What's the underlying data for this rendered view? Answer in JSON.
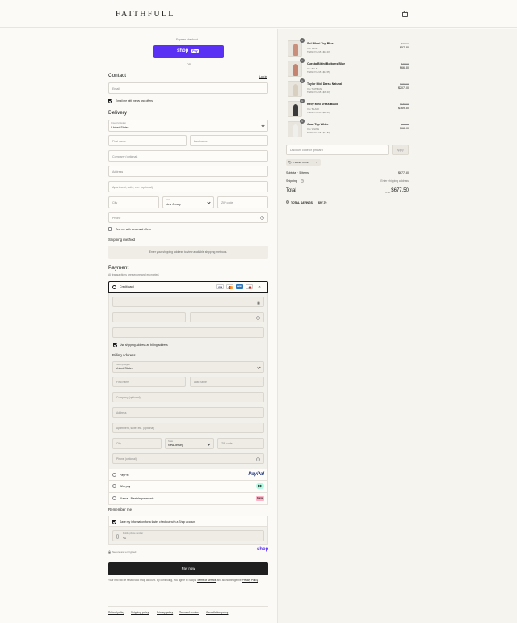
{
  "brand": "FAITHFULL",
  "express": {
    "label": "Express checkout",
    "shop_pay": "shop",
    "shop_pay_badge": "Pay",
    "or": "OR"
  },
  "contact": {
    "heading": "Contact",
    "login": "Log in",
    "email_placeholder": "Email",
    "newsletter_label": "Email me with news and offers"
  },
  "delivery": {
    "heading": "Delivery",
    "country_label": "Country/Region",
    "country_value": "United States",
    "first_name": "First name",
    "last_name": "Last name",
    "company": "Company (optional)",
    "address": "Address",
    "apartment": "Apartment, suite, etc. (optional)",
    "city": "City",
    "state_label": "State",
    "state_value": "New Jersey",
    "zip": "ZIP code",
    "phone": "Phone",
    "sms_label": "Text me with news and offers"
  },
  "shipping": {
    "heading": "Shipping method",
    "notice": "Enter your shipping address to view available shipping methods."
  },
  "payment": {
    "heading": "Payment",
    "subtext": "All transactions are secure and encrypted.",
    "credit_card": "Credit card",
    "cards": [
      "VISA",
      "MC",
      "AMEX",
      "D"
    ],
    "more_cards": "+5",
    "use_shipping": "Use shipping address as billing address",
    "billing_heading": "Billing address",
    "billing": {
      "country_label": "Country/Region",
      "country_value": "United States",
      "first_name": "First name",
      "last_name": "Last name",
      "company": "Company (optional)",
      "address": "Address",
      "apartment": "Apartment, suite, etc. (optional)",
      "city": "City",
      "state_label": "State",
      "state_value": "New Jersey",
      "zip": "ZIP code",
      "phone": "Phone (optional)"
    },
    "paypal": "PayPal",
    "paypal_logo": "PayPal",
    "afterpay": "Afterpay",
    "klarna": "Klarna - Flexible payments",
    "klarna_logo": "Klarna."
  },
  "remember": {
    "heading": "Remember me",
    "save_label": "Save my information for a faster checkout with a Shop account",
    "mobile_label": "Mobile phone number",
    "mobile_value": "+1",
    "secure_text": "Secure and encrypted",
    "shop_logo": "shop"
  },
  "pay_now": "Pay now",
  "legal": {
    "before": "Your info will be saved to a Shop account. By continuing, you agree to Shop's",
    "terms": "Terms of Service",
    "middle": "and acknowledge the",
    "privacy": "Privacy Policy"
  },
  "footer_links": [
    "Refund policy",
    "Shipping policy",
    "Privacy policy",
    "Terms of service",
    "Cancellation policy"
  ],
  "items": [
    {
      "qty": "1",
      "name": "Sol Bikini Top Blue",
      "variant": "XS / BLUE",
      "tag": "THANKYOU15 (-$10.00)",
      "old": "$68.00",
      "new": "$57.80",
      "color": "#c98f7a"
    },
    {
      "qty": "1",
      "name": "Cuesta Bikini Bottoms Blue",
      "variant": "XS / BLUE",
      "tag": "THANKYOU15 (-$11.55)",
      "old": "$78.00",
      "new": "$66.30",
      "color": "#c4846f"
    },
    {
      "qty": "1",
      "name": "Taylor Midi Dress Natural",
      "variant": "XS / NATURAL",
      "tag": "THANKYOU15 (-$35.00)",
      "old": "$269.00",
      "new": "$207.00",
      "color": "#d8cfc0"
    },
    {
      "qty": "1",
      "name": "Kelly Mini Dress Black",
      "variant": "XS / BLACK",
      "tag": "THANKYOU15 (-$28.00)",
      "old": "$189.00",
      "new": "$169.30",
      "color": "#3a3a3a"
    },
    {
      "qty": "1",
      "name": "Joan Top White",
      "variant": "XS / WHITE",
      "tag": "THANKYOU15 (-$12.80)",
      "old": "$85.00",
      "new": "$68.00",
      "color": "#efefec"
    }
  ],
  "discount": {
    "placeholder": "Discount code or gift card",
    "apply": "Apply",
    "code": "THANKYOU15",
    "remove": "×"
  },
  "summary": {
    "subtotal_label": "Subtotal · 5 items",
    "subtotal_value": "$677.50",
    "shipping_label": "Shipping",
    "shipping_value": "Enter shipping address",
    "total_label": "Total",
    "currency": "USD",
    "total_value": "$677.50",
    "savings_label": "TOTAL SAVINGS",
    "savings_value": "$97.70"
  }
}
